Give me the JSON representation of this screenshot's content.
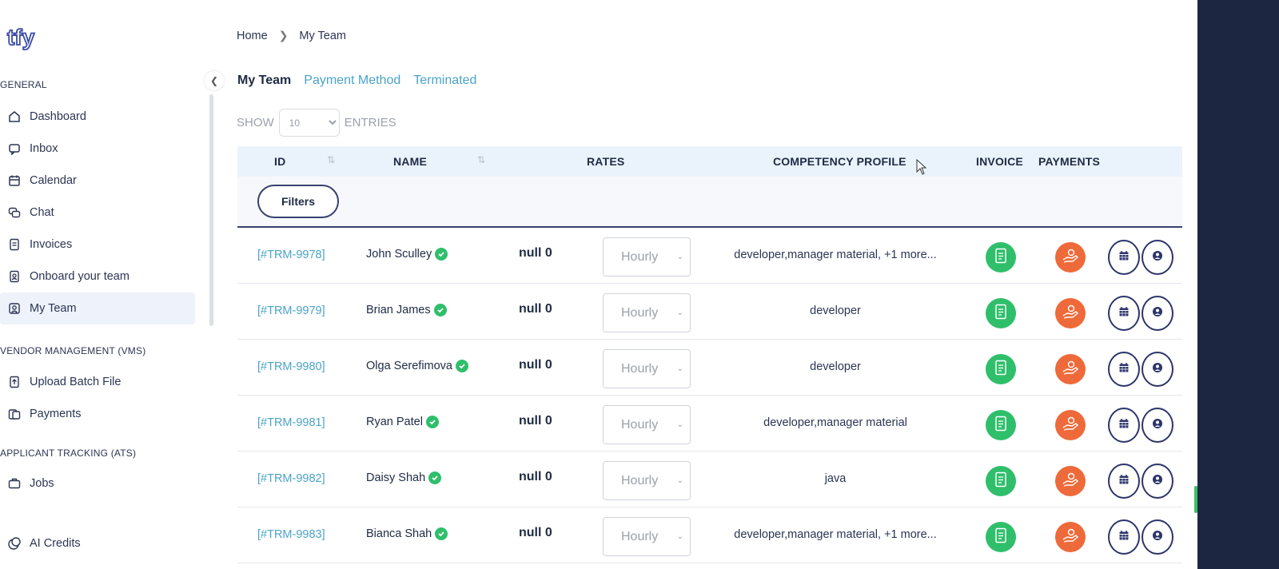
{
  "sidebar": {
    "logo_text": "tfy",
    "sections": [
      {
        "title": "GENERAL"
      },
      {
        "title": "VENDOR MANAGEMENT (VMS)"
      },
      {
        "title": "APPLICANT TRACKING (ATS)"
      }
    ],
    "items": [
      {
        "label": "Dashboard",
        "icon": "home-icon"
      },
      {
        "label": "Inbox",
        "icon": "message-icon"
      },
      {
        "label": "Calendar",
        "icon": "calendar-icon"
      },
      {
        "label": "Chat",
        "icon": "chat-icon"
      },
      {
        "label": "Invoices",
        "icon": "invoice-icon"
      },
      {
        "label": "Onboard your team",
        "icon": "onboard-icon"
      },
      {
        "label": "My Team",
        "icon": "team-icon",
        "active": true
      },
      {
        "label": "Upload Batch File",
        "icon": "upload-file-icon"
      },
      {
        "label": "Payments",
        "icon": "payments-icon"
      },
      {
        "label": "Jobs",
        "icon": "briefcase-icon"
      }
    ],
    "footer_item": {
      "label": "AI Credits",
      "icon": "coins-icon"
    }
  },
  "breadcrumb": {
    "home": "Home",
    "current": "My Team"
  },
  "tabs": [
    {
      "label": "My Team",
      "active": true
    },
    {
      "label": "Payment Method"
    },
    {
      "label": "Terminated"
    }
  ],
  "show_entries": {
    "show_label": "SHOW",
    "value": "10",
    "entries_label": "ENTRIES"
  },
  "table": {
    "headers": {
      "id": "ID",
      "name": "NAME",
      "rates": "RATES",
      "competency": "COMPETENCY PROFILE",
      "invoice": "INVOICE",
      "payments": "PAYMENTS"
    },
    "filters_label": "Filters",
    "rows": [
      {
        "id": "[#TRM-9978]",
        "name": "John Sculley",
        "rate": "null 0",
        "rate_type": "Hourly",
        "competency": "developer,manager material, +1 more..."
      },
      {
        "id": "[#TRM-9979]",
        "name": "Brian James",
        "rate": "null 0",
        "rate_type": "Hourly",
        "competency": "developer"
      },
      {
        "id": "[#TRM-9980]",
        "name": "Olga Serefimova",
        "rate": "null 0",
        "rate_type": "Hourly",
        "competency": "developer"
      },
      {
        "id": "[#TRM-9981]",
        "name": "Ryan Patel",
        "rate": "null 0",
        "rate_type": "Hourly",
        "competency": "developer,manager material"
      },
      {
        "id": "[#TRM-9982]",
        "name": "Daisy Shah",
        "rate": "null 0",
        "rate_type": "Hourly",
        "competency": "java"
      },
      {
        "id": "[#TRM-9983]",
        "name": "Bianca Shah",
        "rate": "null 0",
        "rate_type": "Hourly",
        "competency": "developer,manager material, +1 more..."
      }
    ]
  },
  "colors": {
    "accent_link": "#4aa3c9",
    "navy": "#1f2a44",
    "invoice_green": "#2fbf6b",
    "payment_orange": "#ee6a3a",
    "header_bg": "#eaf3fb",
    "dark_strip": "#1d2640"
  }
}
